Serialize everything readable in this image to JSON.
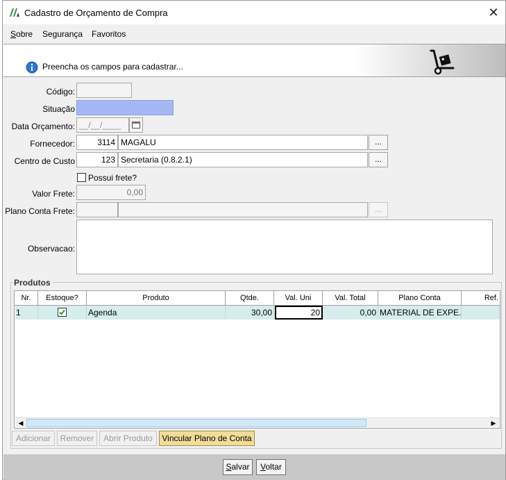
{
  "window": {
    "title": "Cadastro de Orçamento de Compra",
    "close_glyph": "✕"
  },
  "menu": {
    "items": [
      {
        "first": "S",
        "rest": "obre"
      },
      {
        "first": "",
        "rest": "Segurança"
      },
      {
        "first": "",
        "rest": "Favoritos"
      }
    ]
  },
  "banner": {
    "text": "Preencha os campos para cadastrar...",
    "icon": "info-icon",
    "image": "hand-truck-icon"
  },
  "form": {
    "codigo_label": "Código:",
    "codigo_value": "",
    "situacao_label": "Situação",
    "situacao_value": "",
    "situacao_color": "#a6b8f4",
    "data_label": "Data Orçamento:",
    "data_value": "__/__/____",
    "fornecedor_label": "Fornecedor:",
    "fornecedor_code": "3114",
    "fornecedor_name": "MAGALU",
    "centro_label": "Centro de Custo",
    "centro_code": "123",
    "centro_name": "Secretaria (0.8.2.1)",
    "frete_checkbox_label": "Possui frete?",
    "frete_checked": false,
    "valor_frete_label": "Valor Frete:",
    "valor_frete_value": "0,00",
    "plano_frete_label": "Plano Conta Frete:",
    "plano_frete_code": "",
    "plano_frete_name": "",
    "observacao_label": "Observacao:",
    "observacao_value": "",
    "lookup_button": "..."
  },
  "produtos": {
    "group_title": "Produtos",
    "columns": [
      "Nr.",
      "Estoque?",
      "Produto",
      "Qtde.",
      "Val. Uni",
      "Val. Total",
      "Plano Conta",
      "Ref."
    ],
    "rows": [
      {
        "nr": "1",
        "estoque": true,
        "produto": "Agenda",
        "qtde": "30,00",
        "val_uni": "20",
        "val_total": "0,00",
        "plano_conta": "MATERIAL DE EXPE...",
        "ref": ""
      }
    ],
    "buttons": {
      "adicionar": "Adicionar",
      "remover": "Remover",
      "abrir": "Abrir Produto",
      "vincular": "Vincular Plano de Conta"
    }
  },
  "footer": {
    "salvar_first": "S",
    "salvar_rest": "alvar",
    "voltar_first": "V",
    "voltar_rest": "oltar"
  }
}
